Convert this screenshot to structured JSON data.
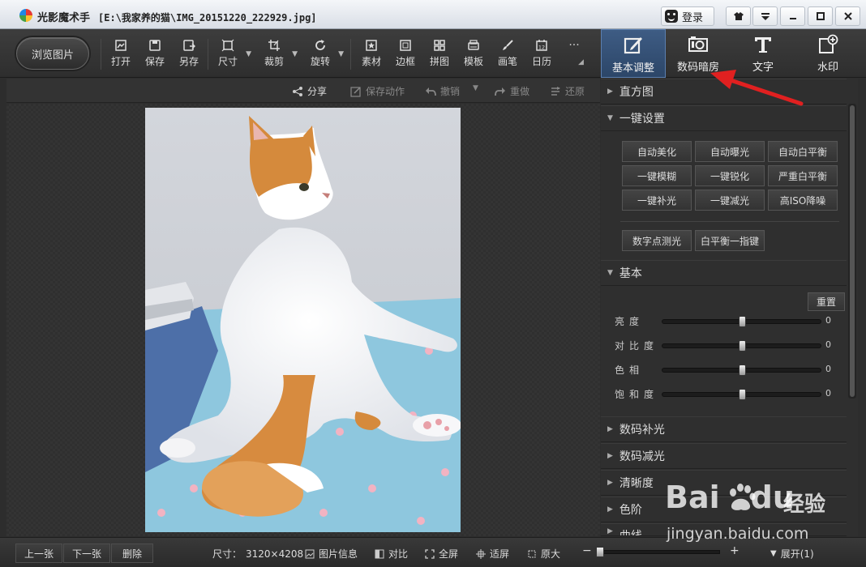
{
  "titlebar": {
    "app_name": "光影魔术手",
    "file_path": "[E:\\我家养的猫\\IMG_20151220_222929.jpg]",
    "login_label": "登录"
  },
  "toolbar": {
    "browse_label": "浏览图片",
    "tools": [
      {
        "label": "打开",
        "icon": "open-icon"
      },
      {
        "label": "保存",
        "icon": "save-icon"
      },
      {
        "label": "另存",
        "icon": "save-as-icon"
      },
      {
        "label": "尺寸",
        "icon": "resize-icon"
      },
      {
        "label": "裁剪",
        "icon": "crop-icon"
      },
      {
        "label": "旋转",
        "icon": "rotate-icon"
      },
      {
        "label": "素材",
        "icon": "material-icon"
      },
      {
        "label": "边框",
        "icon": "border-icon"
      },
      {
        "label": "拼图",
        "icon": "collage-icon"
      },
      {
        "label": "模板",
        "icon": "template-icon"
      },
      {
        "label": "画笔",
        "icon": "brush-icon"
      },
      {
        "label": "日历",
        "icon": "calendar-icon"
      }
    ],
    "more_glyph": "···",
    "calendar_day": "12",
    "tabs": [
      {
        "label": "基本调整",
        "active": true
      },
      {
        "label": "数码暗房",
        "active": false
      },
      {
        "label": "文字",
        "active": false
      },
      {
        "label": "水印",
        "active": false
      }
    ]
  },
  "subbar": {
    "share": "分享",
    "save_action": "保存动作",
    "undo": "撤销",
    "redo": "重做",
    "restore": "还原"
  },
  "panel": {
    "histogram": "直方图",
    "one_click": "一键设置",
    "one_click_buttons": [
      "自动美化",
      "自动曝光",
      "自动白平衡",
      "一键模糊",
      "一键锐化",
      "严重白平衡",
      "一键补光",
      "一键减光",
      "高ISO降噪"
    ],
    "extra_buttons": [
      "数字点测光",
      "白平衡一指键"
    ],
    "basic": "基本",
    "reset": "重置",
    "sliders": [
      {
        "label": "亮度",
        "value": 0,
        "display": "0"
      },
      {
        "label": "对比度",
        "value": 0,
        "display": "0"
      },
      {
        "label": "色相",
        "value": 0,
        "display": "0"
      },
      {
        "label": "饱和度",
        "value": 0,
        "display": "0"
      }
    ],
    "collapsed_sections": [
      "数码补光",
      "数码减光",
      "清晰度",
      "色阶",
      "曲线"
    ]
  },
  "statusbar": {
    "prev": "上一张",
    "next": "下一张",
    "delete": "删除",
    "size_label": "尺寸：",
    "size_value": "3120×4208",
    "info": "图片信息",
    "compare": "对比",
    "fullscreen": "全屏",
    "fit": "适屏",
    "original": "原大",
    "zoom_minus": "−",
    "zoom_plus": "+",
    "expand": "展开(1)"
  },
  "watermark": {
    "brand_a": "Bai",
    "brand_b": "du",
    "brand_cn": "经验",
    "url": "jingyan.baidu.com"
  },
  "colors": {
    "annotation_arrow": "#e02020",
    "active_tab": "#34557d"
  }
}
